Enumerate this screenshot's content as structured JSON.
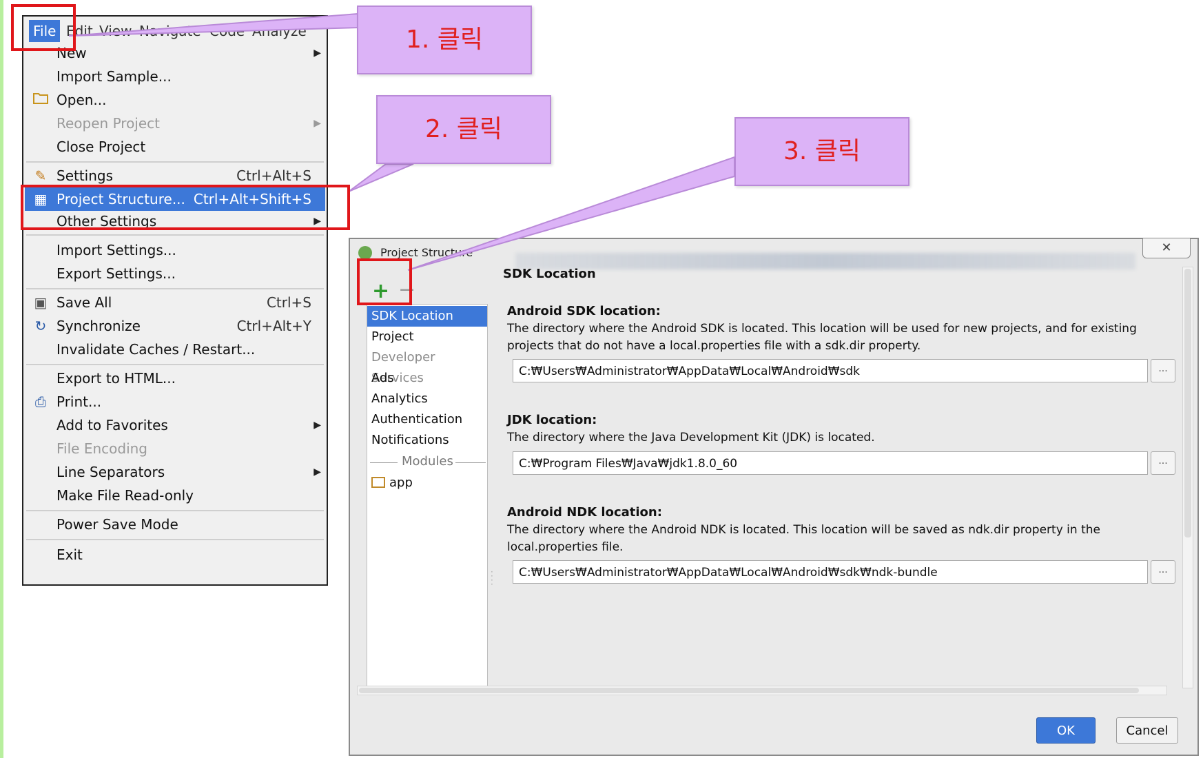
{
  "menubar": {
    "items": [
      "File",
      "Edit",
      "View",
      "Navigate",
      "Code",
      "Analyze"
    ]
  },
  "file_menu": {
    "items": [
      {
        "label": "New",
        "submenu": true
      },
      {
        "label": "Import Sample..."
      },
      {
        "label": "Open...",
        "icon": "folder-icon"
      },
      {
        "label": "Reopen Project",
        "disabled": true,
        "submenu": true
      },
      {
        "label": "Close Project"
      },
      {
        "label": "Settings",
        "shortcut": "Ctrl+Alt+S",
        "icon": "wrench-icon"
      },
      {
        "label": "Project Structure...",
        "shortcut": "Ctrl+Alt+Shift+S",
        "icon": "project-structure-icon",
        "highlighted": true
      },
      {
        "label": "Other Settings",
        "submenu": true
      },
      {
        "label": "Import Settings..."
      },
      {
        "label": "Export Settings..."
      },
      {
        "label": "Save All",
        "shortcut": "Ctrl+S",
        "icon": "save-icon"
      },
      {
        "label": "Synchronize",
        "shortcut": "Ctrl+Alt+Y",
        "icon": "sync-icon"
      },
      {
        "label": "Invalidate Caches / Restart..."
      },
      {
        "label": "Export to HTML..."
      },
      {
        "label": "Print...",
        "icon": "print-icon"
      },
      {
        "label": "Add to Favorites",
        "submenu": true
      },
      {
        "label": "File Encoding",
        "disabled": true
      },
      {
        "label": "Line Separators",
        "submenu": true
      },
      {
        "label": "Make File Read-only"
      },
      {
        "label": "Power Save Mode"
      },
      {
        "label": "Exit"
      }
    ]
  },
  "callouts": {
    "step1": "1. 클릭",
    "step2": "2. 클릭",
    "step3": "3. 클릭"
  },
  "dialog": {
    "title": "Project Structure",
    "close_symbol": "✕",
    "add_symbol": "+",
    "remove_symbol": "−",
    "sidebar": {
      "items": [
        "SDK Location",
        "Project",
        "Developer Services",
        "Ads",
        "Analytics",
        "Authentication",
        "Notifications"
      ],
      "modules_label": "Modules",
      "module_item": "app"
    },
    "section_title": "SDK Location",
    "android_sdk": {
      "heading": "Android SDK location:",
      "description": "The directory where the Android SDK is located. This location will be used for new projects, and for existing projects that do not have a local.properties file with a sdk.dir property.",
      "path": "C:₩Users₩Administrator₩AppData₩Local₩Android₩sdk"
    },
    "jdk": {
      "heading": "JDK location:",
      "description": "The directory where the Java Development Kit (JDK) is located.",
      "path": "C:₩Program Files₩Java₩jdk1.8.0_60"
    },
    "android_ndk": {
      "heading": "Android NDK location:",
      "description": "The directory where the Android NDK is located. This location will be saved as ndk.dir property in the local.properties file.",
      "path": "C:₩Users₩Administrator₩AppData₩Local₩Android₩sdk₩ndk-bundle"
    },
    "browse_label": "...",
    "ok_label": "OK",
    "cancel_label": "Cancel"
  },
  "colors": {
    "highlight": "#3d78d8",
    "callout_fill": "#dcb3f7",
    "callout_text": "#e02020",
    "annotation_red": "#e0161a"
  }
}
